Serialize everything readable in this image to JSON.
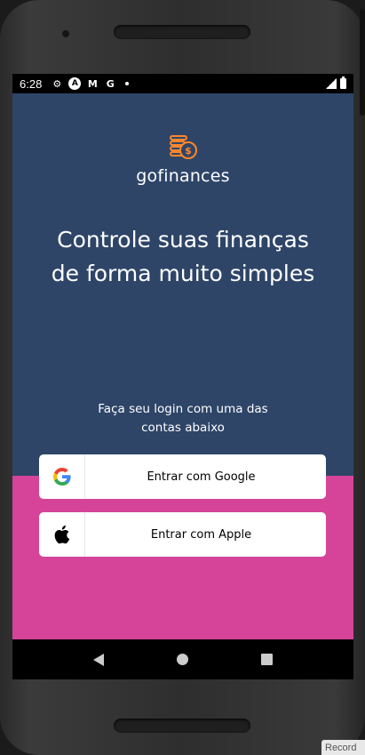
{
  "status_bar": {
    "time": "6:28",
    "icons": [
      "gear-icon",
      "accessibility-a-icon",
      "gmail-icon",
      "google-g-icon",
      "notification-dot"
    ],
    "right_icons": [
      "cell-signal-icon",
      "battery-icon"
    ]
  },
  "app": {
    "brand": "gofinances",
    "headline": "Controle suas finanças de forma muito simples",
    "subtext": "Faça seu login com uma das contas abaixo",
    "colors": {
      "primary": "#2E4568",
      "secondary": "#D6449A",
      "accent": "#FF872C"
    }
  },
  "buttons": {
    "google_label": "Entrar com Google",
    "apple_label": "Entrar com Apple"
  },
  "emulator": {
    "record_label": "Record"
  }
}
